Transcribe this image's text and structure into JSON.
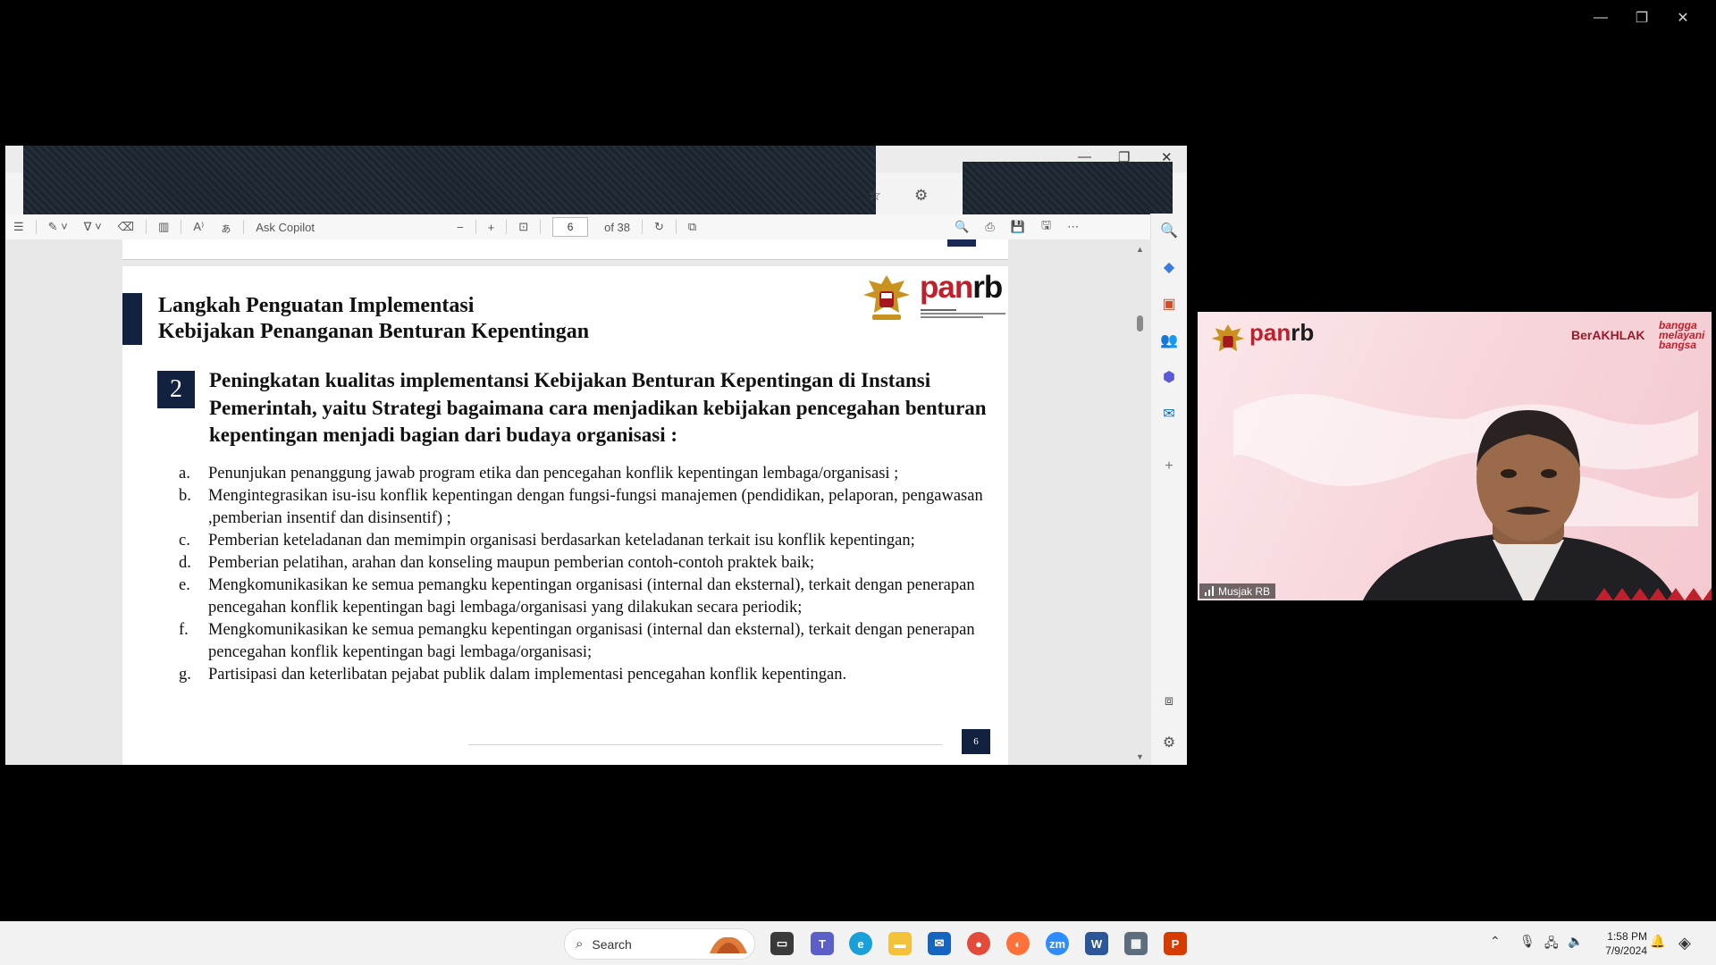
{
  "pdf_toolbar": {
    "ask_copilot": "Ask Copilot",
    "zoom_out": "−",
    "zoom_in": "+",
    "page_current": "6",
    "page_total": "of 38"
  },
  "slide": {
    "title_line1": "Langkah Penguatan Implementasi",
    "title_line2": "Kebijakan Penanganan Benturan Kepentingan",
    "logo_text": "panrb",
    "section_number": "2",
    "heading": "Peningkatan kualitas implementansi Kebijakan Benturan Kepentingan di Instansi Pemerintah,  yaitu Strategi bagaimana cara menjadikan kebijakan pencegahan benturan kepentingan menjadi bagian dari budaya organisasi :",
    "items": [
      {
        "letter": "a.",
        "text": "Penunjukan penanggung jawab program etika dan pencegahan konflik kepentingan lembaga/organisasi ;"
      },
      {
        "letter": "b.",
        "text": "Mengintegrasikan isu-isu konflik kepentingan dengan fungsi-fungsi manajemen (pendidikan, pelaporan, pengawasan ,pemberian insentif dan disinsentif) ;"
      },
      {
        "letter": "c.",
        "text": "Pemberian keteladanan dan memimpin organisasi berdasarkan keteladanan terkait isu konflik kepentingan;"
      },
      {
        "letter": "d.",
        "text": "Pemberian pelatihan, arahan dan konseling maupun pemberian contoh-contoh praktek baik;"
      },
      {
        "letter": "e.",
        "text": "Mengkomunikasikan ke semua pemangku kepentingan organisasi (internal dan eksternal), terkait dengan penerapan pencegahan konflik kepentingan bagi lembaga/organisasi yang dilakukan secara periodik;"
      },
      {
        "letter": "f.",
        "text": "Mengkomunikasikan ke semua pemangku kepentingan organisasi (internal dan eksternal), terkait dengan penerapan pencegahan konflik kepentingan bagi lembaga/organisasi;"
      },
      {
        "letter": "g.",
        "text": "Partisipasi dan keterlibatan pejabat publik dalam implementasi pencegahan konflik kepentingan."
      }
    ],
    "page_number": "6"
  },
  "video": {
    "logo_text": "panrb",
    "berakhlak": "BerAKHLAK",
    "bangga": "bangga melayani bangsa",
    "participant_name": "Musjak RB"
  },
  "taskbar": {
    "search_placeholder": "Search",
    "time": "1:58 PM",
    "date": "7/9/2024"
  },
  "colors": {
    "navy": "#12213f",
    "panrb_red": "#c0202c",
    "taskbar_bg": "#f2f2f3"
  }
}
